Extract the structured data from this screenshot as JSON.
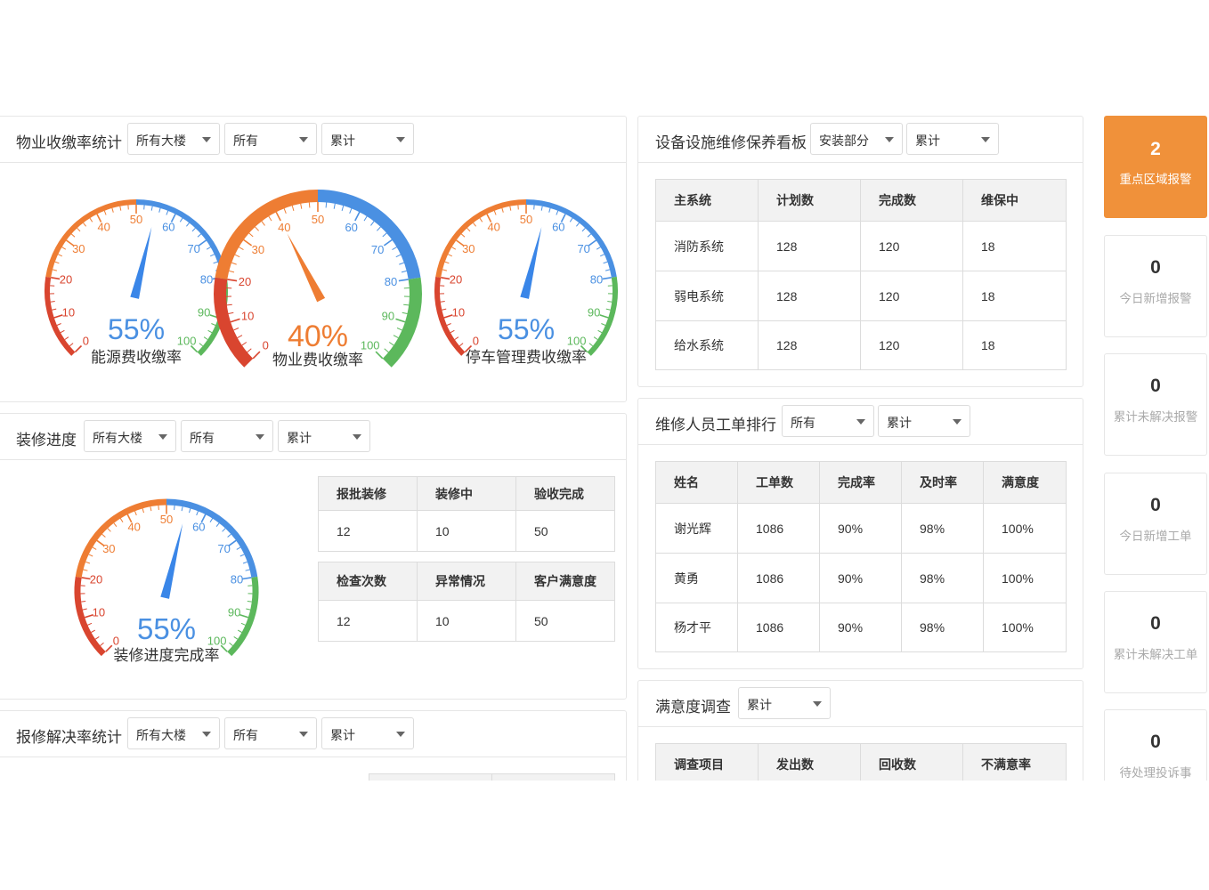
{
  "fee": {
    "title": "物业收缴率统计",
    "filters": [
      "所有大楼",
      "所有",
      "累计"
    ],
    "gauges": [
      {
        "label": "能源费收缴率",
        "value": 55,
        "display": "55%",
        "ticks": [
          "0",
          "10",
          "20",
          "30",
          "40",
          "50",
          "60",
          "70",
          "80",
          "90",
          "100"
        ],
        "needle_color": "#3a86e8",
        "percent_color": "#4a90e2"
      },
      {
        "label": "物业费收缴率",
        "value": 40,
        "display": "40%",
        "ticks": [
          "0",
          "10",
          "20",
          "30",
          "40",
          "50",
          "60",
          "70",
          "80",
          "90",
          "100"
        ],
        "needle_color": "#ee7d33",
        "percent_color": "#ee7d33"
      },
      {
        "label": "停车管理费收缴率",
        "value": 55,
        "display": "55%",
        "ticks": [
          "0",
          "10",
          "20",
          "30",
          "40",
          "50",
          "60",
          "70",
          "80",
          "90",
          "100"
        ],
        "needle_color": "#3a86e8",
        "percent_color": "#4a90e2"
      }
    ]
  },
  "renovation": {
    "title": "装修进度",
    "filters": [
      "所有大楼",
      "所有",
      "累计"
    ],
    "gauge": {
      "label": "装修进度完成率",
      "value": 55,
      "display": "55%",
      "ticks": [
        "0",
        "10",
        "20",
        "30",
        "40",
        "50",
        "60",
        "70",
        "80",
        "90",
        "100"
      ],
      "needle_color": "#3a86e8",
      "percent_color": "#4a90e2"
    },
    "table1": {
      "headers": [
        "报批装修",
        "装修中",
        "验收完成"
      ],
      "row": [
        "12",
        "10",
        "50"
      ]
    },
    "table2": {
      "headers": [
        "检查次数",
        "异常情况",
        "客户满意度"
      ],
      "row": [
        "12",
        "10",
        "50"
      ]
    }
  },
  "repair": {
    "title": "报修解决率统计",
    "filters": [
      "所有大楼",
      "所有",
      "累计"
    ]
  },
  "equipment": {
    "title": "设备设施维修保养看板",
    "filters": [
      "安装部分",
      "累计"
    ],
    "headers": [
      "主系统",
      "计划数",
      "完成数",
      "维保中"
    ],
    "rows": [
      [
        "消防系统",
        "128",
        "120",
        "18"
      ],
      [
        "弱电系统",
        "128",
        "120",
        "18"
      ],
      [
        "给水系统",
        "128",
        "120",
        "18"
      ]
    ]
  },
  "ranking": {
    "title": "维修人员工单排行",
    "filters": [
      "所有",
      "累计"
    ],
    "headers": [
      "姓名",
      "工单数",
      "完成率",
      "及时率",
      "满意度"
    ],
    "rows": [
      [
        "谢光辉",
        "1086",
        "90%",
        "98%",
        "100%"
      ],
      [
        "黄勇",
        "1086",
        "90%",
        "98%",
        "100%"
      ],
      [
        "杨才平",
        "1086",
        "90%",
        "98%",
        "100%"
      ]
    ]
  },
  "satisfaction": {
    "title": "满意度调查",
    "filters": [
      "累计"
    ],
    "headers": [
      "调查项目",
      "发出数",
      "回收数",
      "不满意率"
    ]
  },
  "kpis": [
    {
      "value": "2",
      "label": "重点区域报警",
      "active": true
    },
    {
      "value": "0",
      "label": "今日新增报警",
      "active": false
    },
    {
      "value": "0",
      "label": "累计未解决报警",
      "active": false
    },
    {
      "value": "0",
      "label": "今日新增工单",
      "active": false
    },
    {
      "value": "0",
      "label": "累计未解决工单",
      "active": false
    },
    {
      "value": "0",
      "label": "待处理投诉事",
      "active": false
    }
  ],
  "colors": {
    "red": "#d9452f",
    "orange": "#ee7d33",
    "blue": "#4a90e2",
    "green": "#5cb85c",
    "accent": "#f0913a"
  }
}
